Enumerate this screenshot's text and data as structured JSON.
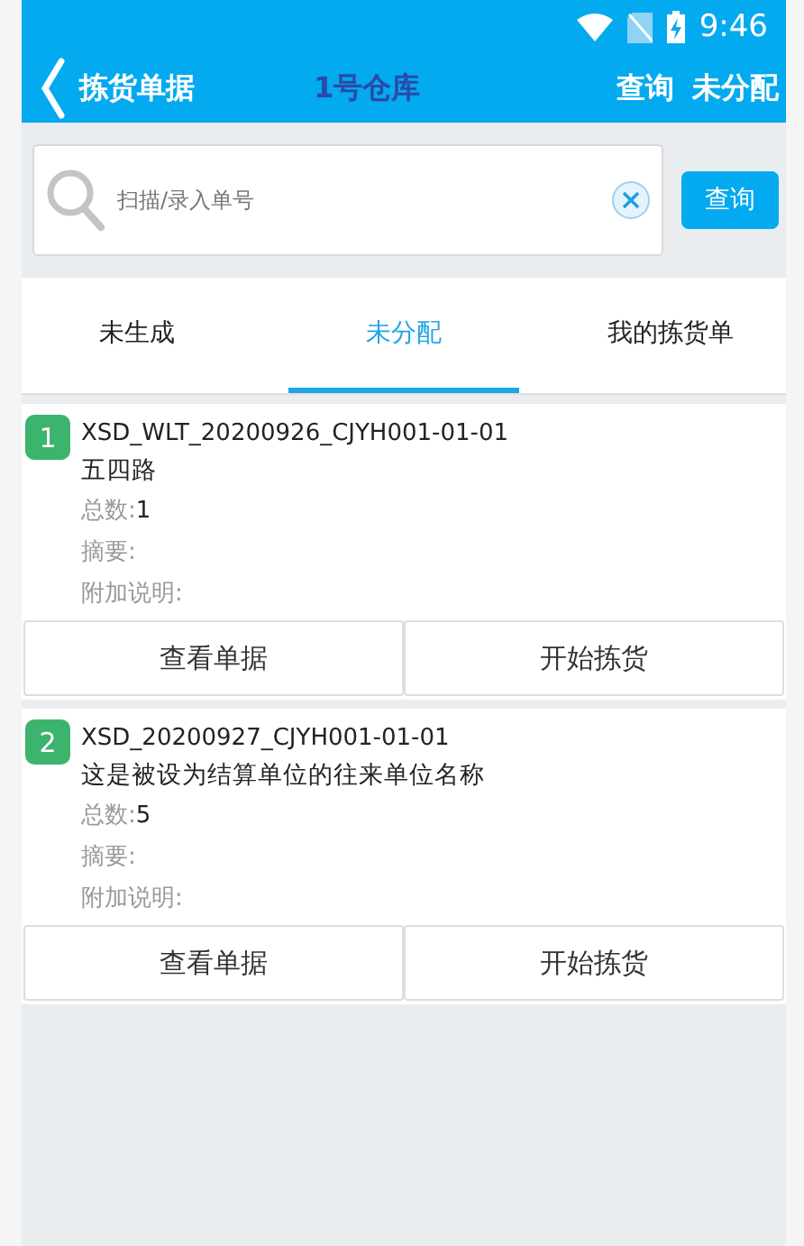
{
  "status_bar": {
    "time": "9:46"
  },
  "header": {
    "back_label": "拣货单据",
    "title": "1号仓库",
    "actions": [
      "查询",
      "未分配"
    ]
  },
  "search": {
    "placeholder": "扫描/录入单号",
    "button": "查询"
  },
  "tabs": [
    {
      "label": "未生成",
      "selected": false
    },
    {
      "label": "未分配",
      "selected": true
    },
    {
      "label": "我的拣货单",
      "selected": false
    }
  ],
  "orders": [
    {
      "index": "1",
      "code": "XSD_WLT_20200926_CJYH001-01-01",
      "name": "五四路",
      "fields": [
        {
          "label": "总数:",
          "value": "1"
        },
        {
          "label": "摘要:"
        },
        {
          "label": "附加说明:"
        }
      ],
      "buttons": [
        "查看单据",
        "开始拣货"
      ]
    },
    {
      "index": "2",
      "code": "XSD_20200927_CJYH001-01-01",
      "name": "这是被设为结算单位的往来单位名称",
      "fields": [
        {
          "label": "总数:",
          "value": "5"
        },
        {
          "label": "摘要:"
        },
        {
          "label": "附加说明:"
        }
      ],
      "buttons": [
        "查看单据",
        "开始拣货"
      ]
    }
  ]
}
